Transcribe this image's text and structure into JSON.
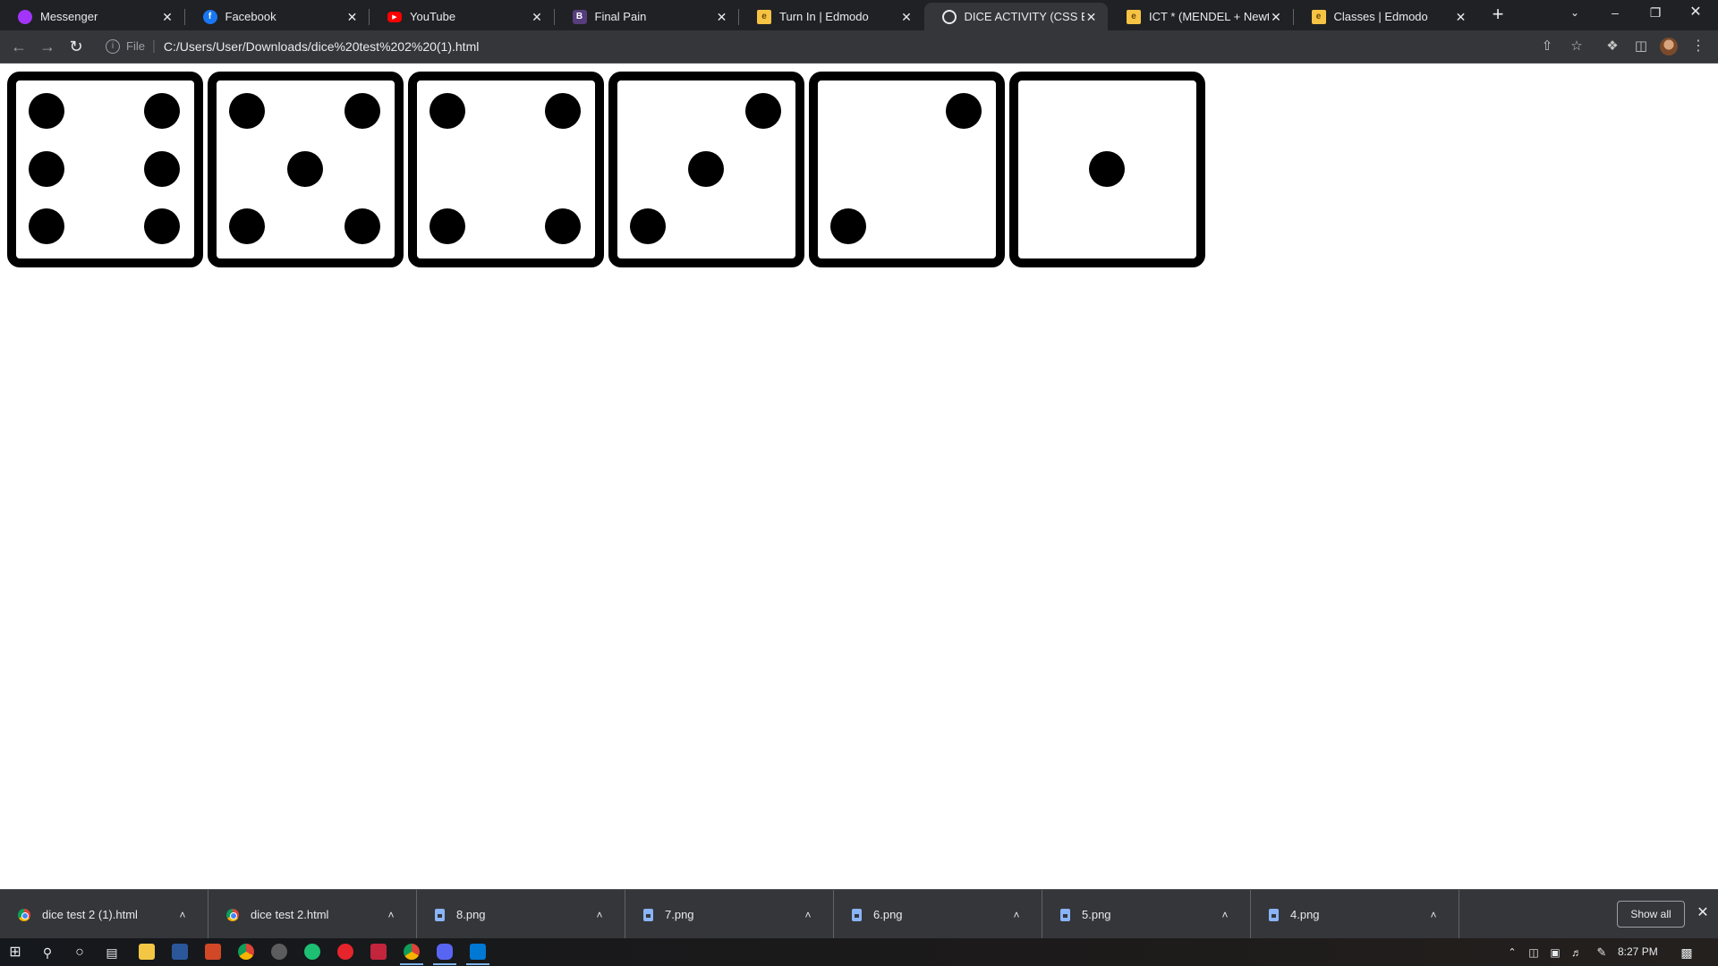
{
  "tabs": [
    {
      "title": "Messenger",
      "icon": "messenger-icon",
      "color": "#a334fa"
    },
    {
      "title": "Facebook",
      "icon": "facebook-icon",
      "color": "#1877f2"
    },
    {
      "title": "YouTube",
      "icon": "youtube-icon",
      "color": "#ff0000"
    },
    {
      "title": "Final Pain",
      "icon": "bootstrap-icon",
      "color": "#563d7c"
    },
    {
      "title": "Turn In | Edmodo",
      "icon": "edmodo-icon",
      "color": "#f6c344"
    },
    {
      "title": "DICE ACTIVITY (CSS BOX M",
      "icon": "globe-icon",
      "color": "#e8eaed"
    },
    {
      "title": "ICT * (MENDEL + Newton)",
      "icon": "edmodo-icon",
      "color": "#f6c344"
    },
    {
      "title": "Classes | Edmodo",
      "icon": "edmodo-icon",
      "color": "#f6c344"
    }
  ],
  "active_tab": 5,
  "address_bar": {
    "scheme": "File",
    "url": "C:/Users/User/Downloads/dice%20test%202%20(1).html"
  },
  "dice": [
    {
      "value": 6,
      "pips": [
        "tl",
        "ml",
        "bl",
        "tr",
        "mr",
        "br"
      ]
    },
    {
      "value": 5,
      "pips": [
        "tl",
        "tr",
        "c",
        "bl",
        "br"
      ]
    },
    {
      "value": 4,
      "pips": [
        "tl",
        "tr",
        "bl",
        "br"
      ]
    },
    {
      "value": 3,
      "pips": [
        "tr",
        "c",
        "bl"
      ]
    },
    {
      "value": 2,
      "pips": [
        "tr",
        "bl"
      ]
    },
    {
      "value": 1,
      "pips": [
        "c"
      ]
    }
  ],
  "downloads": [
    {
      "name": "dice test 2 (1).html",
      "type": "chrome-html"
    },
    {
      "name": "dice test 2.html",
      "type": "chrome-html"
    },
    {
      "name": "8.png",
      "type": "image"
    },
    {
      "name": "7.png",
      "type": "image"
    },
    {
      "name": "6.png",
      "type": "image"
    },
    {
      "name": "5.png",
      "type": "image"
    },
    {
      "name": "4.png",
      "type": "image"
    }
  ],
  "shelf": {
    "show_all": "Show all"
  },
  "taskbar": {
    "clock": "8:27 PM"
  }
}
